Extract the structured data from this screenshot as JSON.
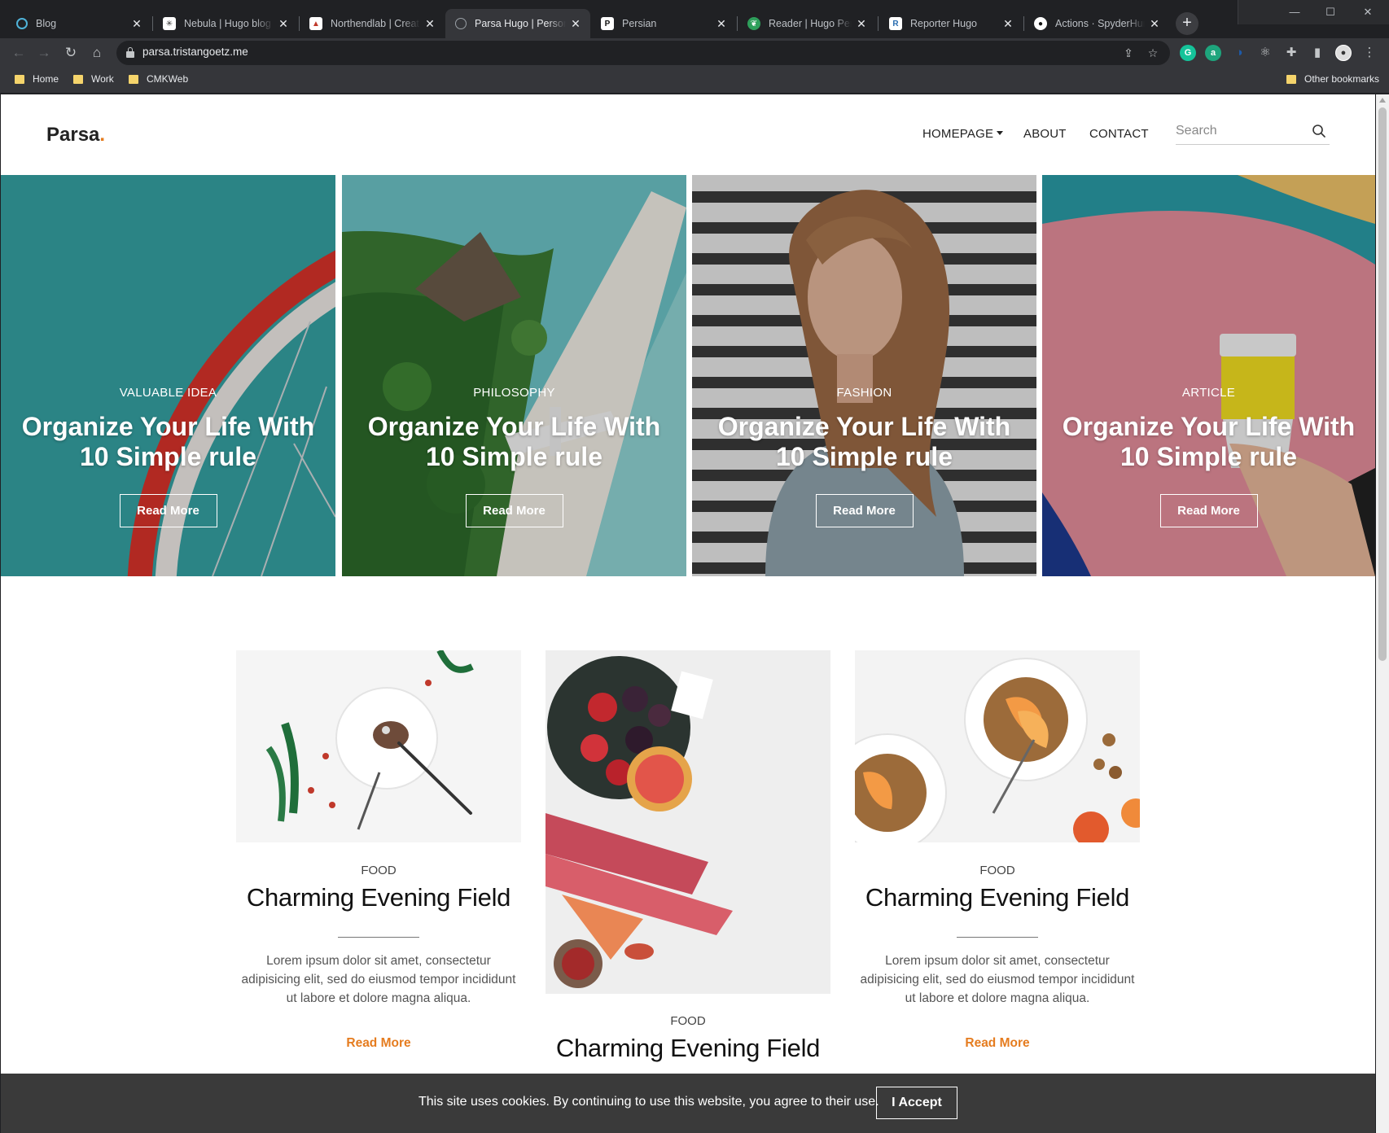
{
  "browser": {
    "tabs": [
      {
        "title": "Blog",
        "favicon": "hugo-circle-icon",
        "active": false
      },
      {
        "title": "Nebula | Hugo blog t",
        "favicon": "nebula-icon",
        "active": false
      },
      {
        "title": "Northendlab | Creativ",
        "favicon": "northendlab-icon",
        "active": false
      },
      {
        "title": "Parsa Hugo | Personal",
        "favicon": "globe-icon",
        "active": true
      },
      {
        "title": "Persian",
        "favicon": "persian-p-icon",
        "active": false
      },
      {
        "title": "Reader | Hugo Persor",
        "favicon": "reader-leaf-icon",
        "active": false
      },
      {
        "title": "Reporter Hugo",
        "favicon": "reporter-icon",
        "active": false
      },
      {
        "title": "Actions · SpyderHunt",
        "favicon": "github-icon",
        "active": false
      }
    ],
    "url": "parsa.tristangoetz.me",
    "bookmarks": [
      "Home",
      "Work",
      "CMKWeb"
    ],
    "other_bookmarks": "Other bookmarks"
  },
  "site": {
    "logo": "Parsa",
    "logo_dot": ".",
    "nav": {
      "homepage": "HOMEPAGE",
      "about": "ABOUT",
      "contact": "CONTACT"
    },
    "search_placeholder": "Search"
  },
  "slider": [
    {
      "category": "VALUABLE IDEA",
      "title": "Organize Your Life With 10 Simple rule",
      "button": "Read More",
      "image": "red-bicycle-wheel-teal-wall"
    },
    {
      "category": "PHILOSOPHY",
      "title": "Organize Your Life With 10 Simple rule",
      "button": "Read More",
      "image": "tropical-island-seaplane"
    },
    {
      "category": "FASHION",
      "title": "Organize Your Life With 10 Simple rule",
      "button": "Read More",
      "image": "woman-portrait-striped-wall"
    },
    {
      "category": "ARTICLE",
      "title": "Organize Your Life With 10 Simple rule",
      "button": "Read More",
      "image": "coffee-cup-pink-wall"
    }
  ],
  "posts": [
    {
      "category": "FOOD",
      "title": "Charming Evening Field",
      "excerpt": "Lorem ipsum dolor sit amet, consectetur adipisicing elit, sed do eiusmod tempor incididunt ut labore et dolore magna aliqua.",
      "read_more": "Read More",
      "image": "dessert-plate-with-fork"
    },
    {
      "category": "FOOD",
      "title": "Charming Evening Field",
      "image": "fruit-bowl-rhubarb-flatlay"
    },
    {
      "category": "FOOD",
      "title": "Charming Evening Field",
      "excerpt": "Lorem ipsum dolor sit amet, consectetur adipisicing elit, sed do eiusmod tempor incididunt ut labore et dolore magna aliqua.",
      "read_more": "Read More",
      "image": "granola-peach-bowls"
    }
  ],
  "cookie": {
    "message": "This site uses cookies. By continuing to use this website, you agree to their use.",
    "accept": "I Accept"
  },
  "colors": {
    "accent": "#e57c1f",
    "chrome_dark": "#202124",
    "chrome_mid": "#35363a",
    "cookie_bar": "#3a3a3a"
  }
}
